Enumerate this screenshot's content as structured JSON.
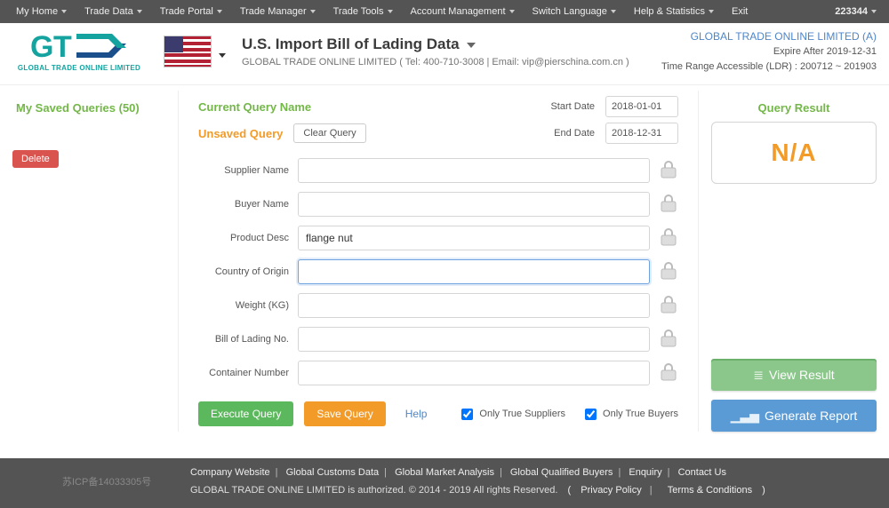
{
  "nav": {
    "items": [
      "My Home",
      "Trade Data",
      "Trade Portal",
      "Trade Manager",
      "Trade Tools",
      "Account Management",
      "Switch Language",
      "Help & Statistics",
      "Exit"
    ],
    "account": "223344"
  },
  "logo": {
    "sub": "GLOBAL  TRADE  ONLINE LIMITED"
  },
  "header": {
    "title": "U.S. Import Bill of Lading Data",
    "sub": "GLOBAL TRADE ONLINE LIMITED ( Tel: 400-710-3008 | Email: vip@pierschina.com.cn )"
  },
  "account_info": {
    "name": "GLOBAL TRADE ONLINE LIMITED (A)",
    "expire": "Expire After 2019-12-31",
    "range": "Time Range Accessible (LDR) : 200712 ~ 201903"
  },
  "left": {
    "title": "My Saved Queries (50)",
    "delete_label": "Delete"
  },
  "query": {
    "cqn_label": "Current Query Name",
    "unsaved_label": "Unsaved Query",
    "clear_label": "Clear Query",
    "start_label": "Start Date",
    "end_label": "End Date",
    "start_value": "2018-01-01",
    "end_value": "2018-12-31",
    "fields": {
      "supplier": {
        "label": "Supplier Name",
        "value": ""
      },
      "buyer": {
        "label": "Buyer Name",
        "value": ""
      },
      "product": {
        "label": "Product Desc",
        "value": "flange nut"
      },
      "country": {
        "label": "Country of Origin",
        "value": ""
      },
      "weight": {
        "label": "Weight (KG)",
        "value": ""
      },
      "bol": {
        "label": "Bill of Lading No.",
        "value": ""
      },
      "container": {
        "label": "Container Number",
        "value": ""
      }
    },
    "exec_label": "Execute Query",
    "save_label": "Save Query",
    "help_label": "Help",
    "only_suppliers": "Only True Suppliers",
    "only_buyers": "Only True Buyers"
  },
  "result": {
    "title": "Query Result",
    "value": "N/A",
    "view_label": "View Result",
    "report_label": "Generate Report"
  },
  "footer": {
    "links": [
      "Company Website",
      "Global Customs Data",
      "Global Market Analysis",
      "Global Qualified Buyers",
      "Enquiry",
      "Contact Us"
    ],
    "icp": "苏ICP备14033305号",
    "copy_pre": "GLOBAL TRADE ONLINE LIMITED is authorized. © 2014 - 2019 All rights Reserved.",
    "legal_open": "(",
    "privacy": "Privacy Policy",
    "terms": "Terms & Conditions",
    "legal_close": ")"
  }
}
